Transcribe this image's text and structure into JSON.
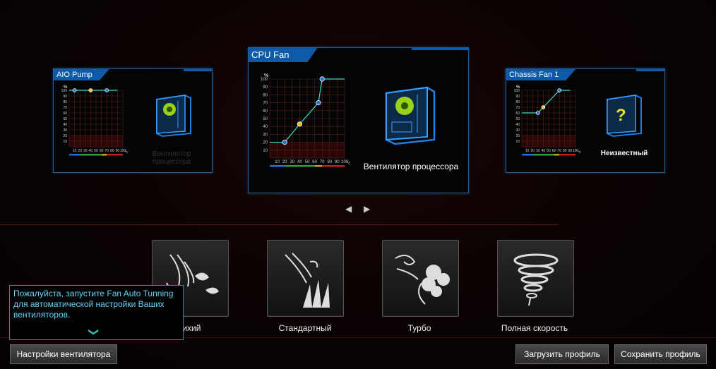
{
  "cards": {
    "left": {
      "title": "AIO Pump",
      "fan_label": "Вентилятор процессора",
      "unit_y": "%",
      "unit_x": "°c",
      "y_ticks": [
        "100",
        "90",
        "80",
        "70",
        "60",
        "50",
        "40",
        "30",
        "20",
        "10"
      ],
      "x_ticks": [
        "10",
        "20",
        "30",
        "40",
        "50",
        "60",
        "70",
        "80",
        "90",
        "100"
      ]
    },
    "center": {
      "title": "CPU Fan",
      "fan_label": "Вентилятор процессора",
      "unit_y": "%",
      "unit_x": "°c",
      "y_ticks": [
        "100",
        "90",
        "80",
        "70",
        "60",
        "50",
        "40",
        "30",
        "20",
        "10"
      ],
      "x_ticks": [
        "10",
        "20",
        "30",
        "40",
        "50",
        "60",
        "70",
        "80",
        "90",
        "100"
      ]
    },
    "right": {
      "title": "Chassis Fan 1",
      "fan_label": "Неизвестный",
      "unit_y": "%",
      "unit_x": "°c",
      "y_ticks": [
        "100",
        "90",
        "80",
        "70",
        "60",
        "50",
        "40",
        "30",
        "20",
        "10"
      ],
      "x_ticks": [
        "10",
        "20",
        "30",
        "40",
        "50",
        "60",
        "70",
        "80",
        "90",
        "100"
      ]
    }
  },
  "chart_data": [
    {
      "type": "line",
      "title": "AIO Pump",
      "xlim": [
        0,
        100
      ],
      "ylim": [
        0,
        100
      ],
      "x": [
        0,
        10,
        40,
        70,
        90
      ],
      "y": [
        100,
        100,
        100,
        100,
        100
      ],
      "points": [
        10,
        40,
        70
      ]
    },
    {
      "type": "line",
      "title": "CPU Fan",
      "xlim": [
        0,
        100
      ],
      "ylim": [
        0,
        100
      ],
      "x": [
        0,
        20,
        40,
        65,
        70,
        100
      ],
      "y": [
        20,
        20,
        43,
        70,
        100,
        100
      ],
      "points": [
        20,
        40,
        65,
        70
      ]
    },
    {
      "type": "line",
      "title": "Chassis Fan 1",
      "xlim": [
        0,
        100
      ],
      "ylim": [
        0,
        100
      ],
      "x": [
        0,
        30,
        40,
        70,
        90
      ],
      "y": [
        60,
        60,
        70,
        100,
        100
      ],
      "points": [
        30,
        40,
        70
      ]
    }
  ],
  "nav": {
    "prev": "◀",
    "next": "▶"
  },
  "modes": [
    {
      "label": "Тихий"
    },
    {
      "label": "Стандартный"
    },
    {
      "label": "Турбо"
    },
    {
      "label": "Полная скорость"
    }
  ],
  "tooltip": {
    "text": "Пожалуйста, запустите Fan Auto Tunning для автоматической настройки Ваших вентиляторов.",
    "chevron": "❯"
  },
  "buttons": {
    "fan_settings": "Настройки вентилятора",
    "load_profile": "Загрузить профиль",
    "save_profile": "Сохранить профиль"
  }
}
